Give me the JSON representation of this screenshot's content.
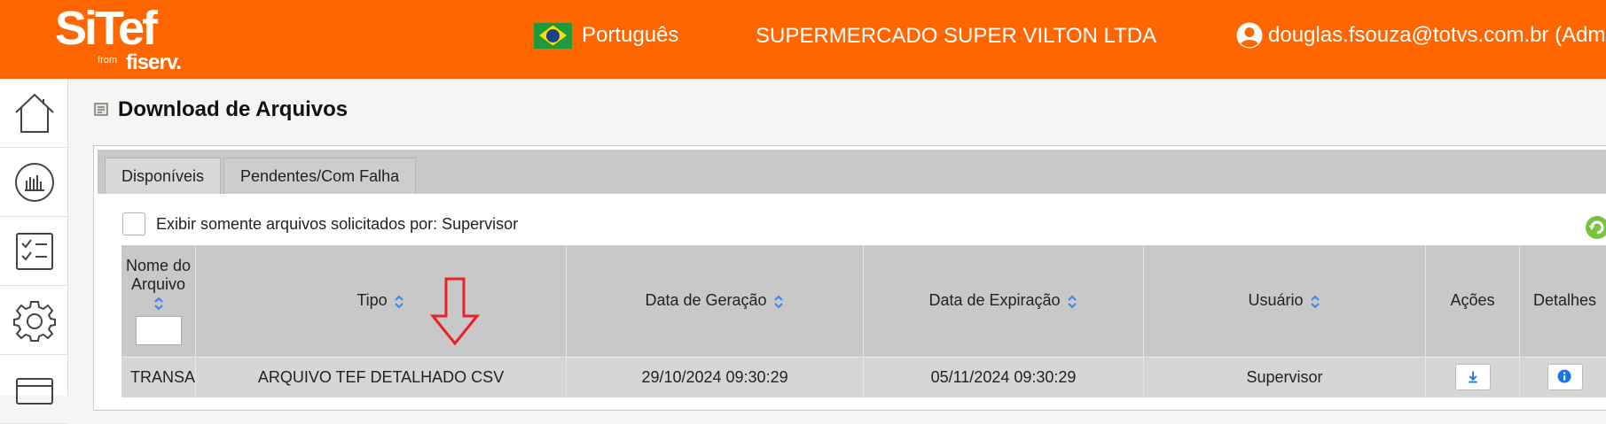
{
  "header": {
    "logo_text": "SiTef",
    "logo_from": "from",
    "logo_brand": "fiserv.",
    "language": "Português",
    "company": "SUPERMERCADO SUPER VILTON LTDA",
    "user": "douglas.fsouza@totvs.com.br (Admi"
  },
  "sidebar": {
    "items": [
      {
        "icon": "home-icon"
      },
      {
        "icon": "chart-icon"
      },
      {
        "icon": "checklist-icon"
      },
      {
        "icon": "gear-icon"
      },
      {
        "icon": "card-icon"
      }
    ]
  },
  "page": {
    "title": "Download de Arquivos"
  },
  "tabs": [
    {
      "label": "Disponíveis",
      "active": true
    },
    {
      "label": "Pendentes/Com Falha",
      "active": false
    }
  ],
  "filter": {
    "label": "Exibir somente arquivos solicitados por: Supervisor",
    "checked": false
  },
  "table": {
    "headers": {
      "nome": "Nome do Arquivo",
      "tipo": "Tipo",
      "geracao": "Data de Geração",
      "expiracao": "Data de Expiração",
      "usuario": "Usuário",
      "acoes": "Ações",
      "detalhes": "Detalhes"
    },
    "rows": [
      {
        "nome": "TRANSA",
        "tipo": "ARQUIVO TEF DETALHADO CSV",
        "geracao": "29/10/2024 09:30:29",
        "expiracao": "05/11/2024 09:30:29",
        "usuario": "Supervisor"
      }
    ]
  },
  "colors": {
    "brand": "#ff6600",
    "accent_blue": "#1a73e8",
    "annotation_red": "#e8202a"
  }
}
